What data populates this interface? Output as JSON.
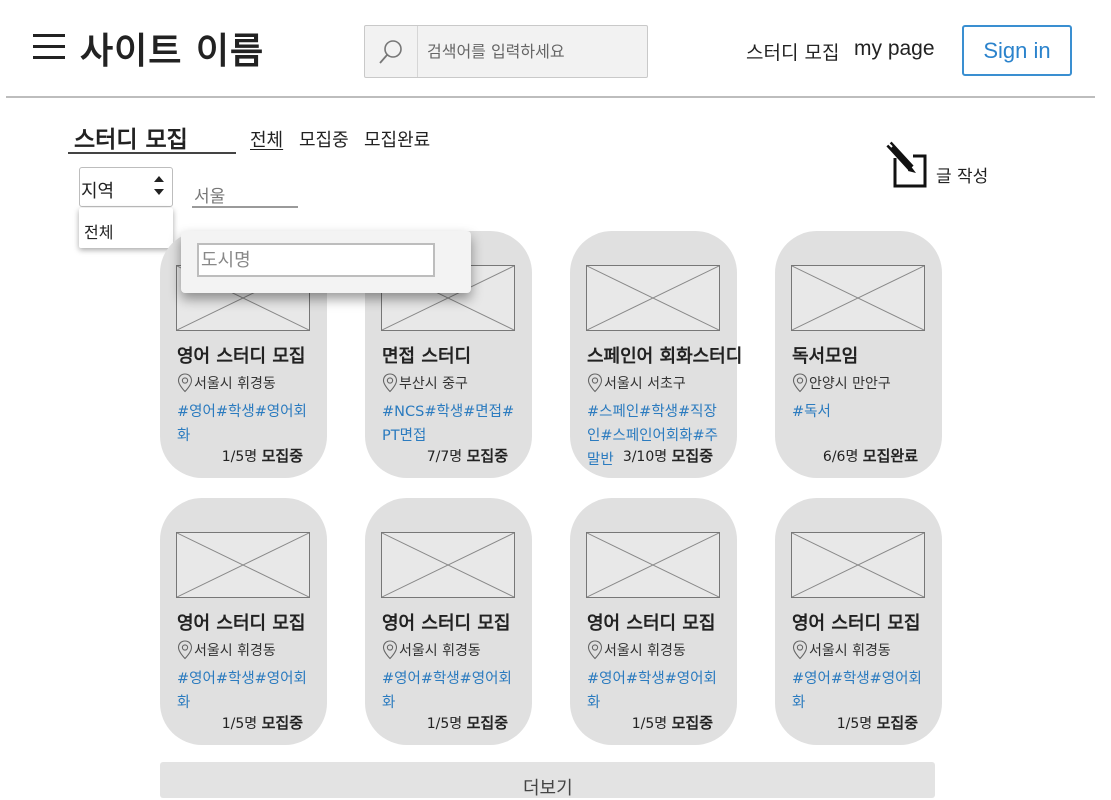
{
  "header": {
    "site_title": "사이트 이름",
    "search_placeholder": "검색어를 입력하세요",
    "nav_study": "스터디 모집",
    "nav_mypage": "my page",
    "signin_label": "Sign in"
  },
  "section": {
    "title": "스터디 모집",
    "tabs": [
      {
        "label": "전체",
        "active": true
      },
      {
        "label": "모집중",
        "active": false
      },
      {
        "label": "모집완료",
        "active": false
      }
    ],
    "write_label": "글 작성"
  },
  "filters": {
    "region_label": "지역",
    "region_option": "전체",
    "city_value": "서울",
    "city_popup_placeholder": "도시명"
  },
  "cards": [
    {
      "title": "영어 스터디 모집",
      "location": "서울시 휘경동",
      "tags": "#영어#학생#영어회화",
      "count": "1/5명",
      "status": "모집중"
    },
    {
      "title": "면접 스터디",
      "location": "부산시 중구",
      "tags": "#NCS#학생#면접#PT면접",
      "count": "7/7명",
      "status": "모집중"
    },
    {
      "title": "스페인어 회화스터디",
      "location": "서울시 서초구",
      "tags": "#스페인#학생#직장인#스페인어회화#주말반",
      "count": "3/10명",
      "status": "모집중"
    },
    {
      "title": "독서모임",
      "location": "안양시 만안구",
      "tags": "#독서",
      "count": "6/6명",
      "status": "모집완료"
    },
    {
      "title": "영어 스터디 모집",
      "location": "서울시 휘경동",
      "tags": "#영어#학생#영어회화",
      "count": "1/5명",
      "status": "모집중"
    },
    {
      "title": "영어 스터디 모집",
      "location": "서울시 휘경동",
      "tags": "#영어#학생#영어회화",
      "count": "1/5명",
      "status": "모집중"
    },
    {
      "title": "영어 스터디 모집",
      "location": "서울시 휘경동",
      "tags": "#영어#학생#영어회화",
      "count": "1/5명",
      "status": "모집중"
    },
    {
      "title": "영어 스터디 모집",
      "location": "서울시 휘경동",
      "tags": "#영어#학생#영어회화",
      "count": "1/5명",
      "status": "모집중"
    }
  ],
  "more_label": "더보기",
  "colors": {
    "accent": "#2b83cc",
    "tag": "#2b7bbf",
    "card_bg": "#e0e0e0"
  }
}
